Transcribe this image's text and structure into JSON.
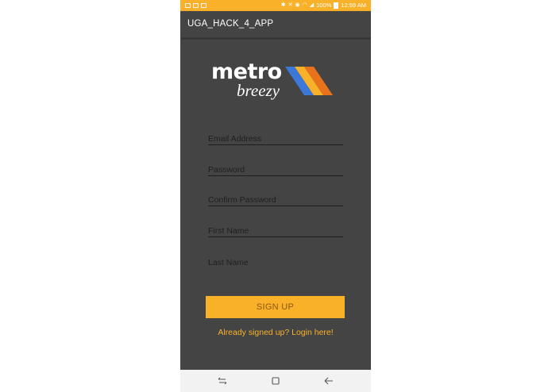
{
  "status_bar": {
    "battery": "100%",
    "time": "12:59 AM"
  },
  "app_bar": {
    "title": "UGA_HACK_4_APP"
  },
  "logo": {
    "word1": "metro",
    "word2": "breezy",
    "stripe_colors": [
      "#3c78d8",
      "#f9b12a",
      "#e8731a"
    ]
  },
  "form": {
    "fields": [
      {
        "placeholder": "Email Address",
        "value": ""
      },
      {
        "placeholder": "Password",
        "value": ""
      },
      {
        "placeholder": "Confirm Password",
        "value": ""
      },
      {
        "placeholder": "First Name",
        "value": ""
      },
      {
        "placeholder": "Last Name",
        "value": ""
      }
    ],
    "submit_label": "SIGN UP",
    "login_link": "Already signed up? Login here!"
  },
  "nav_bar": {
    "icons": [
      "recent-apps-icon",
      "home-icon",
      "back-icon"
    ]
  },
  "colors": {
    "accent": "#f9b12a",
    "background": "#444444"
  }
}
